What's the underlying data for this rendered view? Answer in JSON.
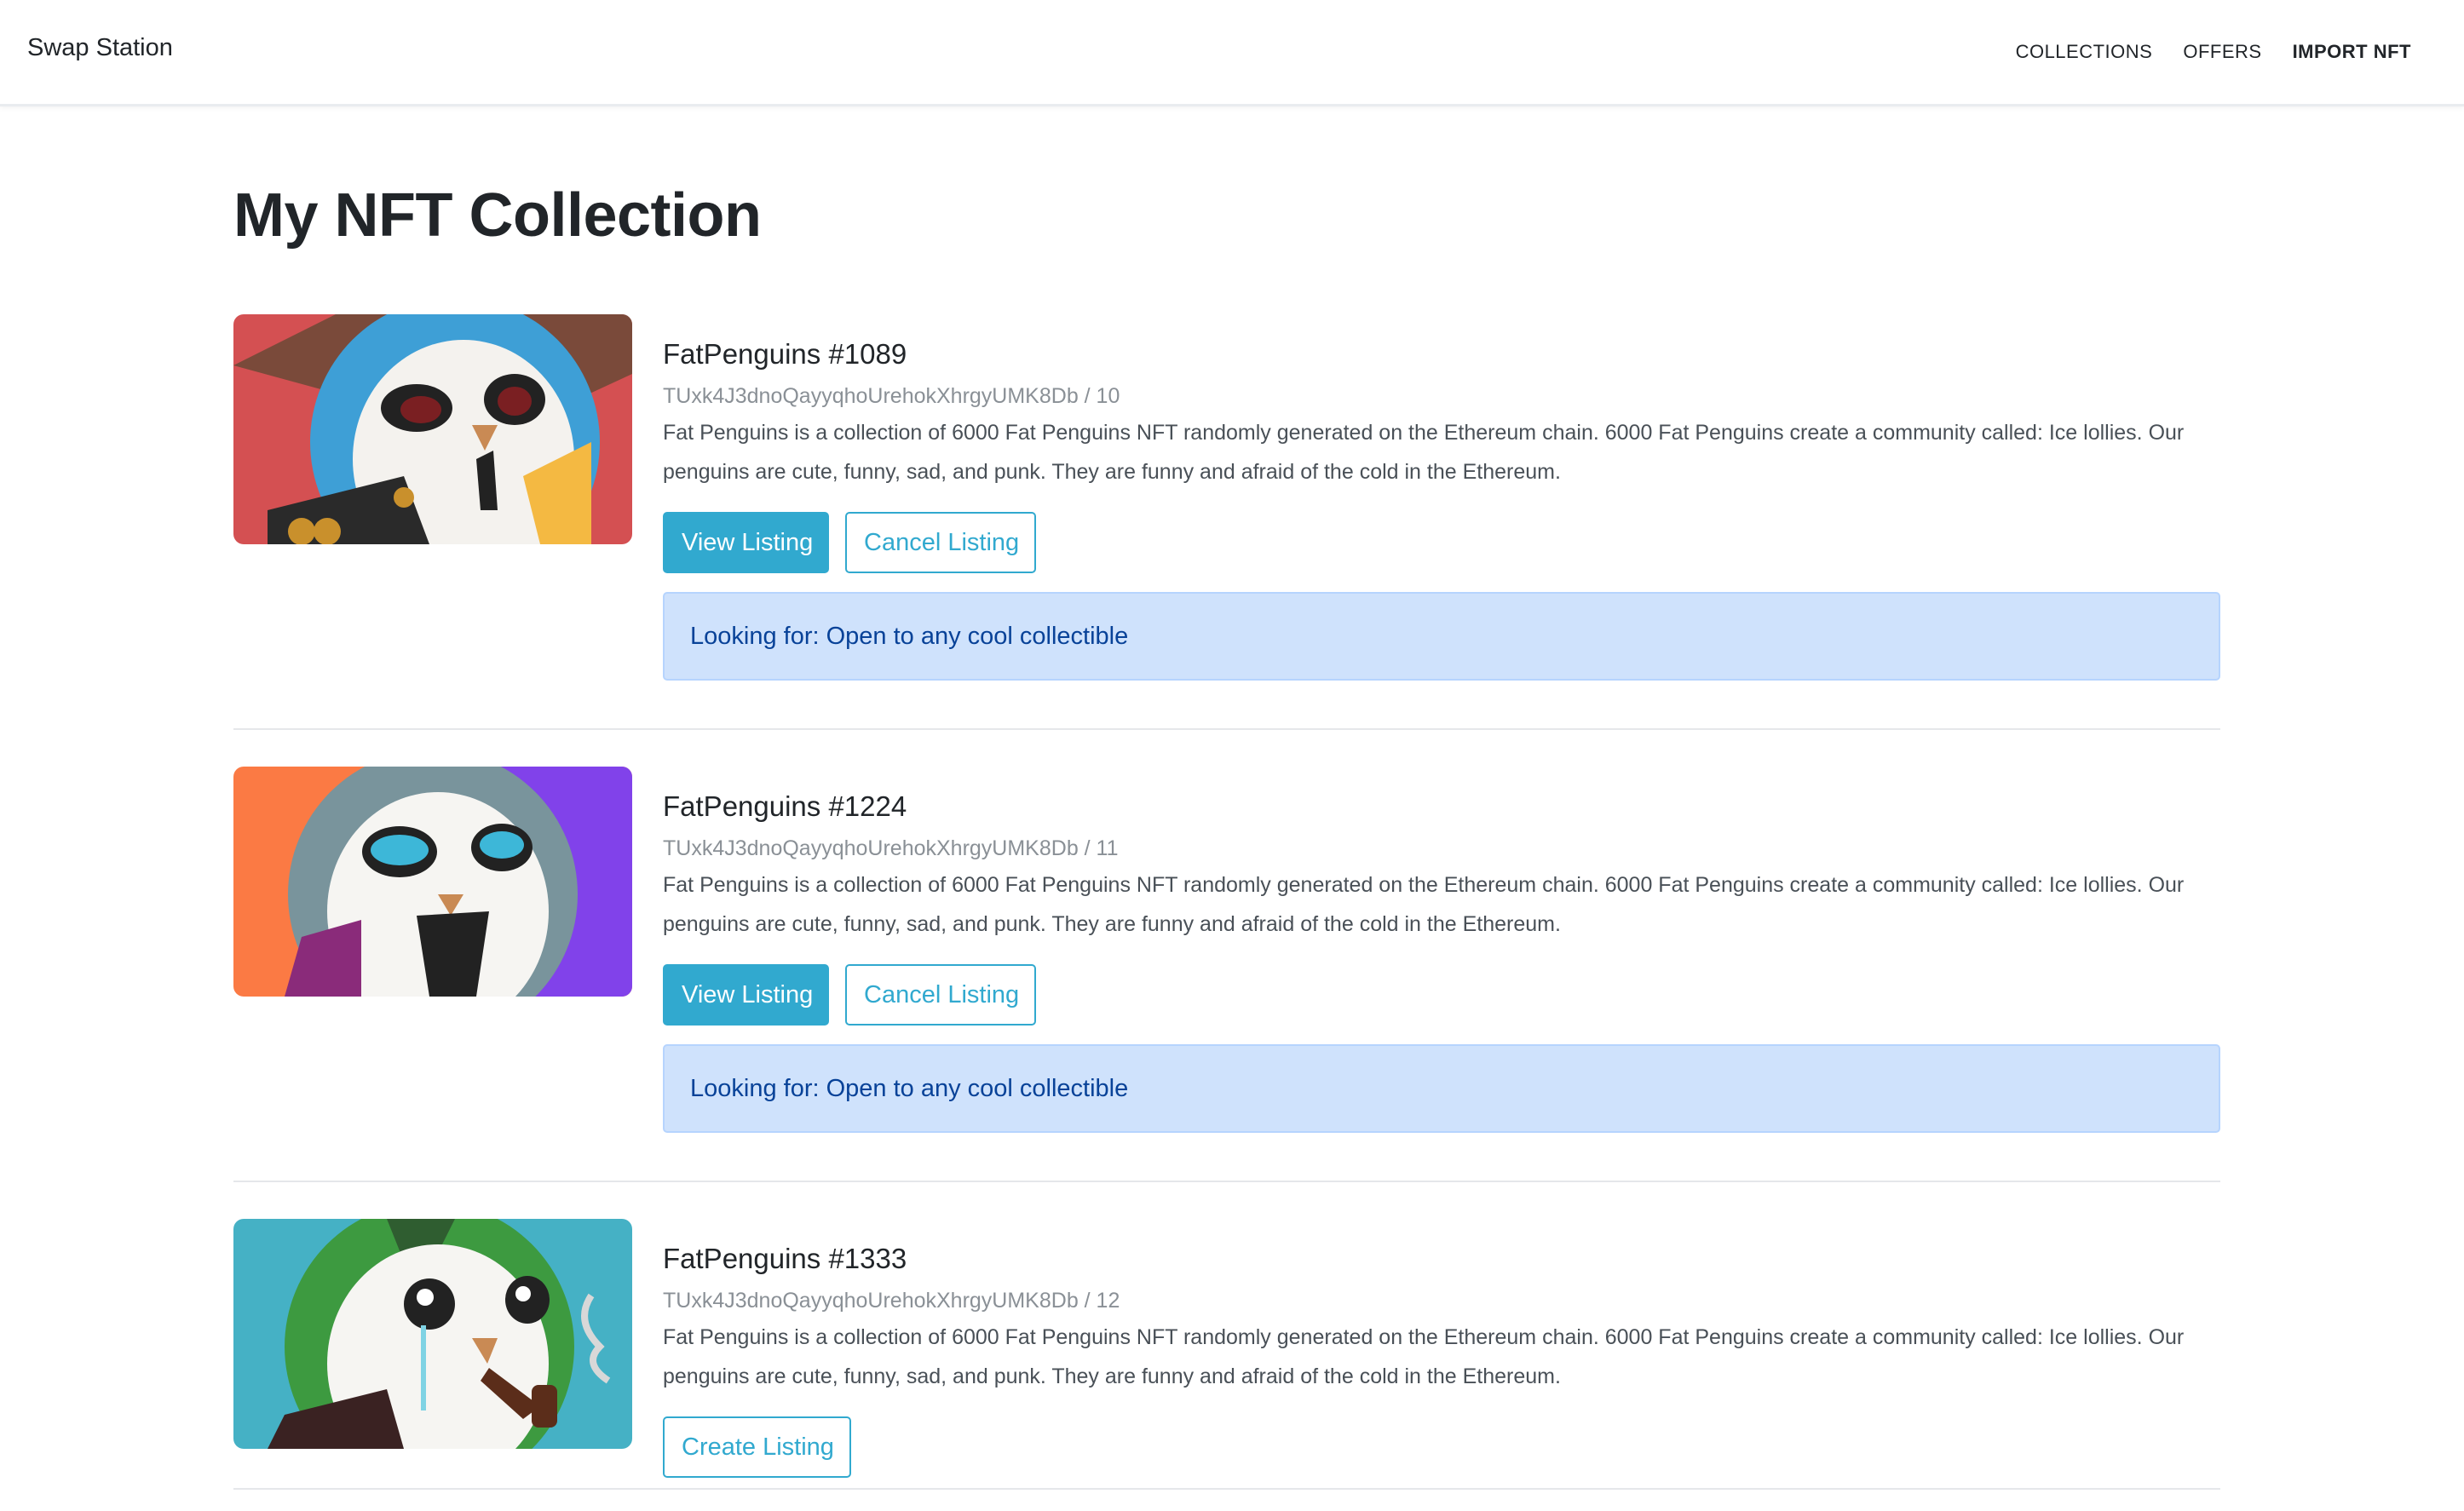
{
  "navbar": {
    "brand": "Swap Station",
    "links": [
      {
        "label": "COLLECTIONS"
      },
      {
        "label": "OFFERS"
      },
      {
        "label": "IMPORT NFT"
      }
    ]
  },
  "page": {
    "title": "My NFT Collection"
  },
  "items": [
    {
      "title": "FatPenguins #1089",
      "subtitle": "TUxk4J3dnoQayyqhoUrehokXhrgyUMK8Db / 10",
      "description": "Fat Penguins is a collection of 6000 Fat Penguins NFT randomly generated on the Ethereum chain. 6000 Fat Penguins create a community called: Ice lollies. Our penguins are cute, funny, sad, and punk. They are funny and afraid of the cold in the Ethereum.",
      "buttons": {
        "view": "View Listing",
        "cancel": "Cancel Listing"
      },
      "looking_for": "Looking for: Open to any cool collectible"
    },
    {
      "title": "FatPenguins #1224",
      "subtitle": "TUxk4J3dnoQayyqhoUrehokXhrgyUMK8Db / 11",
      "description": "Fat Penguins is a collection of 6000 Fat Penguins NFT randomly generated on the Ethereum chain. 6000 Fat Penguins create a community called: Ice lollies. Our penguins are cute, funny, sad, and punk. They are funny and afraid of the cold in the Ethereum.",
      "buttons": {
        "view": "View Listing",
        "cancel": "Cancel Listing"
      },
      "looking_for": "Looking for: Open to any cool collectible"
    },
    {
      "title": "FatPenguins #1333",
      "subtitle": "TUxk4J3dnoQayyqhoUrehokXhrgyUMK8Db / 12",
      "description": "Fat Penguins is a collection of 6000 Fat Penguins NFT randomly generated on the Ethereum chain. 6000 Fat Penguins create a community called: Ice lollies. Our penguins are cute, funny, sad, and punk. They are funny and afraid of the cold in the Ethereum.",
      "buttons": {
        "create": "Create Listing"
      }
    }
  ]
}
